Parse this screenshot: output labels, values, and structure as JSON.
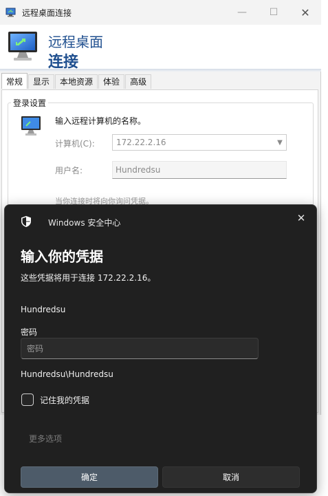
{
  "rdp_window": {
    "title": "远程桌面连接",
    "controls": {
      "minimize": "—",
      "maximize": "☐",
      "close": "✕"
    },
    "header": {
      "line1": "远程桌面",
      "line2": "连接"
    },
    "tabs": [
      {
        "label": "常规",
        "active": true
      },
      {
        "label": "显示"
      },
      {
        "label": "本地资源"
      },
      {
        "label": "体验"
      },
      {
        "label": "高级"
      }
    ],
    "login_settings": {
      "legend": "登录设置",
      "instruction": "输入远程计算机的名称。",
      "computer_label": "计算机(C):",
      "computer_value": "172.22.2.16",
      "username_label": "用户名:",
      "username_value": "Hundredsu",
      "hint": "当你连接时将向你询问凭据。"
    }
  },
  "security_dialog": {
    "app_name": "Windows 安全中心",
    "close_glyph": "✕",
    "title": "输入你的凭据",
    "description": "这些凭据将用于连接 172.22.2.16。",
    "username": "Hundredsu",
    "password_label": "密码",
    "password_placeholder": "密码",
    "domain_user": "Hundredsu\\Hundredsu",
    "remember_label": "记住我的凭据",
    "remember_checked": false,
    "more_options": "更多选项",
    "ok_label": "确定",
    "cancel_label": "取消"
  }
}
